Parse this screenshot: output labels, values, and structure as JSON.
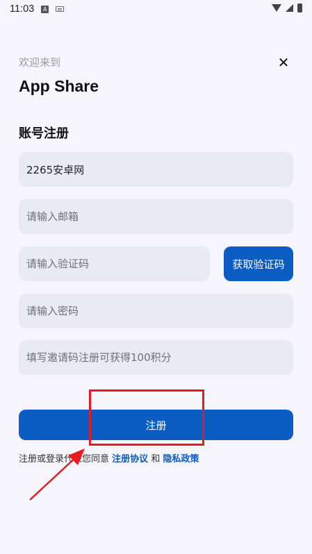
{
  "status_bar": {
    "time": "11:03",
    "icons": [
      "a-notification-icon",
      "keyboard-icon",
      "wifi-icon",
      "signal-icon",
      "battery-icon"
    ]
  },
  "header": {
    "subtitle": "欢迎来到",
    "title": "App Share",
    "close_icon": "close-icon",
    "close_glyph": "✕"
  },
  "form": {
    "section_title": "账号注册",
    "username_value": "2265安卓网",
    "email_placeholder": "请输入邮箱",
    "code_placeholder": "请输入验证码",
    "get_code_label": "获取验证码",
    "password_placeholder": "请输入密码",
    "invite_placeholder": "填写邀请码注册可获得100积分",
    "register_label": "注册"
  },
  "agreement": {
    "prefix": "注册或登录代表您同意",
    "terms_link": "注册协议",
    "conjunction": "和",
    "privacy_link": "隐私政策"
  },
  "annotation": {
    "highlight_color": "#E8191F",
    "accent_color": "#0B5CC3"
  }
}
